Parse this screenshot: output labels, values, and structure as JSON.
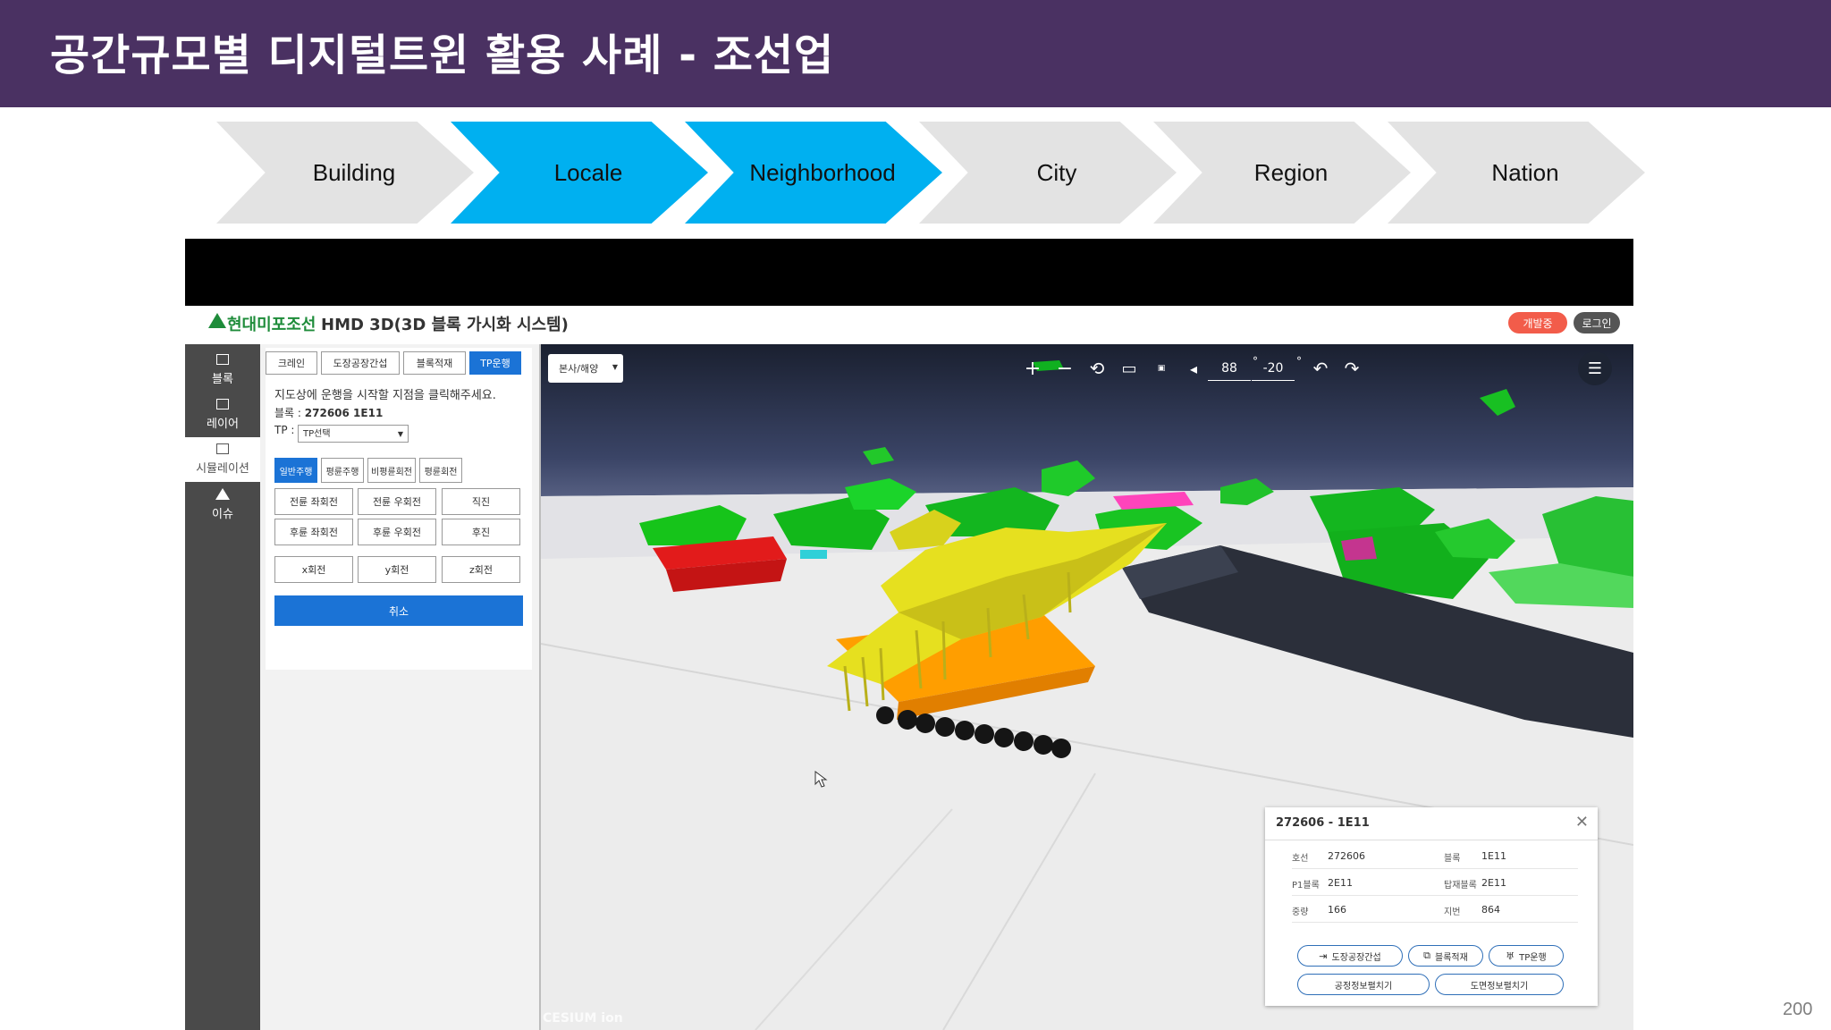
{
  "slide": {
    "title": "공간규모별 디지털트윈 활용 사례  -  조선업",
    "page_number": "200"
  },
  "scales": [
    {
      "label": "Building",
      "active": false
    },
    {
      "label": "Locale",
      "active": true
    },
    {
      "label": "Neighborhood",
      "active": true
    },
    {
      "label": "City",
      "active": false
    },
    {
      "label": "Region",
      "active": false
    },
    {
      "label": "Nation",
      "active": false
    }
  ],
  "colors": {
    "header_bg": "#4a3162",
    "chevron_active": "#00b0f0",
    "chevron_inactive": "#e3e3e3",
    "primary_button": "#1b73d6",
    "brand_green": "#1e8c3a",
    "dev_badge": "#f25c4a"
  },
  "app": {
    "brand": "현대미포조선",
    "title": "HMD 3D(3D 블록 가시화 시스템)",
    "dev_badge": "개발중",
    "login": "로그인",
    "sidebar": [
      {
        "label": "블록",
        "icon": "block-icon"
      },
      {
        "label": "레이어",
        "icon": "layers-icon"
      },
      {
        "label": "시뮬레이션",
        "icon": "simulation-icon",
        "active": true
      },
      {
        "label": "이슈",
        "icon": "warning-icon"
      }
    ],
    "panel": {
      "tabs": [
        "크레인",
        "도장공장간섭",
        "블록적재",
        "TP운행"
      ],
      "active_tab": "TP운행",
      "message": "지도상에 운행을 시작할 지점을 클릭해주세요.",
      "block_label": "블록 :",
      "block_value": "272606 1E11",
      "tp_label": "TP :",
      "tp_select": "TP선택",
      "modes": [
        "일반주행",
        "평륜주행",
        "비평륜회전",
        "평륜회전"
      ],
      "active_mode": "일반주행",
      "moves": [
        "전륜 좌회전",
        "전륜 우회전",
        "직진",
        "후륜 좌회전",
        "후륜 우회전",
        "후진"
      ],
      "rotations": [
        "x회전",
        "y회전",
        "z회전"
      ],
      "cancel": "취소"
    },
    "viewer": {
      "site_select": "본사/해양",
      "heading": "88",
      "pitch": "-20",
      "attribution": "CESIUM ion"
    },
    "info": {
      "title": "272606 - 1E11",
      "rows": [
        {
          "k1": "호선",
          "v1": "272606",
          "k2": "블록",
          "v2": "1E11"
        },
        {
          "k1": "P1블록",
          "v1": "2E11",
          "k2": "탑재블록",
          "v2": "2E11"
        },
        {
          "k1": "중량",
          "v1": "166",
          "k2": "지번",
          "v2": "864"
        }
      ],
      "buttons": [
        "도장공장간섭",
        "블록적재",
        "TP운행"
      ],
      "links": [
        "공정정보펼치기",
        "도면정보펼치기"
      ]
    }
  }
}
